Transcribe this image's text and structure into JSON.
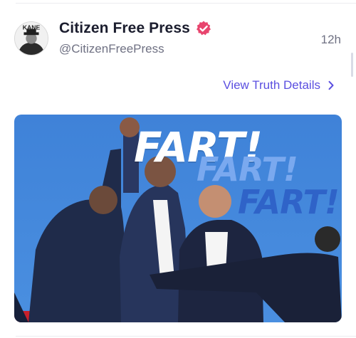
{
  "post": {
    "author_name": "Citizen Free Press",
    "handle": "@CitizenFreePress",
    "time_ago": "12h",
    "avatar_text": "KANE",
    "verified_icon": "verified-badge-icon",
    "details_link": "View Truth Details",
    "details_icon": "chevron-right-icon"
  },
  "media": {
    "overlay_words": [
      "FART!",
      "FART!",
      "FART!"
    ]
  },
  "colors": {
    "accent": "#5b4fe0",
    "verified": "#e8456e",
    "text_primary": "#1b1d2e",
    "text_secondary": "#6f7183",
    "sky": "#3f82d8"
  }
}
